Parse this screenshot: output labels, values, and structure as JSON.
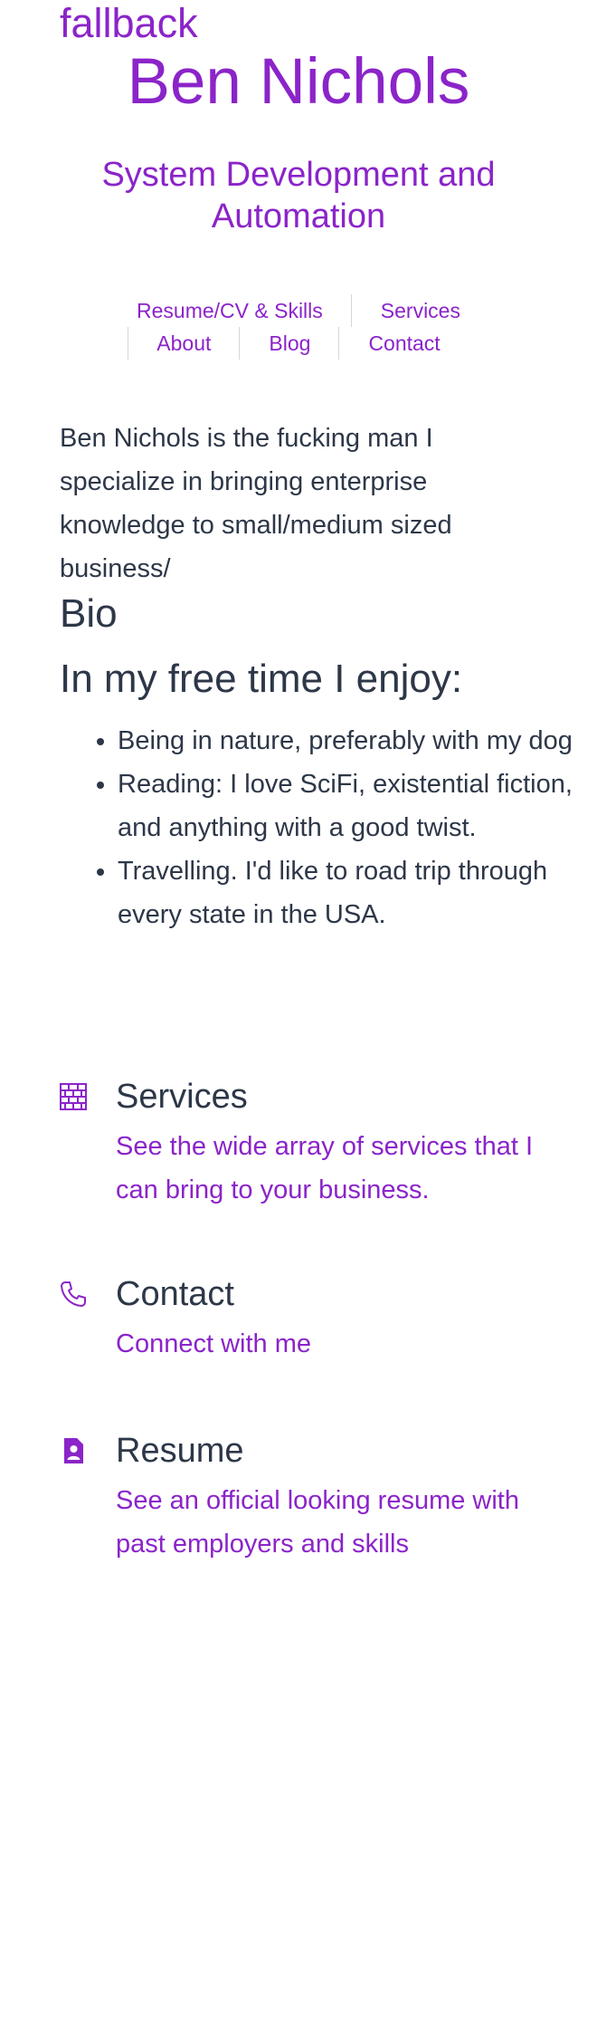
{
  "fallback_text": "fallback",
  "site": {
    "title": "Ben Nichols",
    "tagline": "System Development and Automation"
  },
  "nav": {
    "items": [
      {
        "label": "Resume/CV & Skills"
      },
      {
        "label": "Services"
      },
      {
        "label": "About"
      },
      {
        "label": "Blog"
      },
      {
        "label": "Contact"
      }
    ]
  },
  "intro": "Ben Nichols is the fucking man I specialize in bringing enterprise knowledge to small/medium sized business/",
  "bio": {
    "heading": "Bio",
    "free_time_heading": "In my free time I enjoy:",
    "hobbies": [
      "Being in nature, preferably with my dog",
      "Reading: I love SciFi, existential fiction, and anything with a good twist.",
      "Travelling. I'd like to road trip through every state in the USA."
    ]
  },
  "features": [
    {
      "icon": "brick-wall-icon",
      "title": "Services",
      "link_text": "See the wide array of services that I can bring to your business."
    },
    {
      "icon": "phone-icon",
      "title": "Contact",
      "link_text": "Connect with me"
    },
    {
      "icon": "resume-icon",
      "title": "Resume",
      "link_text": "See an official looking resume with past employers and skills"
    }
  ],
  "colors": {
    "accent": "#8b24c9",
    "text": "#2d3748",
    "divider": "#d2d6dc",
    "background": "#ffffff"
  }
}
